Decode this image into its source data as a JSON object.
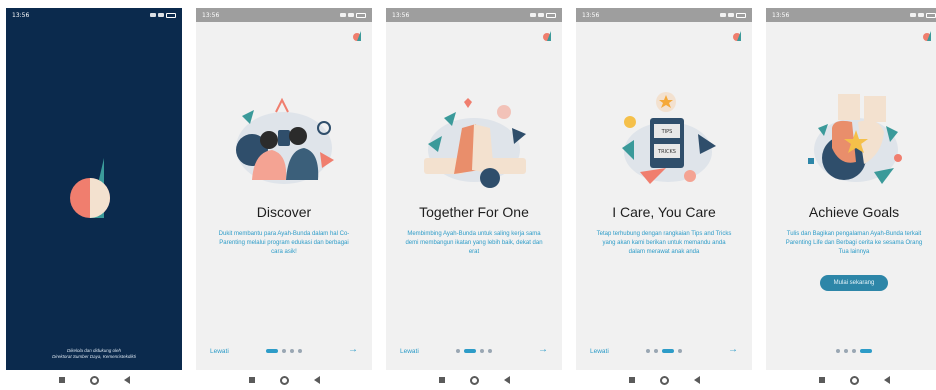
{
  "status_time": "13:56",
  "screens": [
    {
      "type": "splash",
      "footer_line1": "Dikelola dan didukung oleh",
      "footer_line2": "Direktorat Sumber Daya, Kemenristekdikti"
    },
    {
      "type": "onboarding",
      "title": "Discover",
      "description": "Dukit membantu para Ayah-Bunda dalam hal Co-Parenting melalui program edukasi dan berbagai cara asik!",
      "skip_label": "Lewati",
      "next_icon": "arrow-right-icon",
      "active_dot": 0
    },
    {
      "type": "onboarding",
      "title": "Together For One",
      "description": "Membimbing Ayah-Bunda untuk saling kerja sama demi membangun ikatan yang lebih baik, dekat dan erat",
      "skip_label": "Lewati",
      "next_icon": "arrow-right-icon",
      "active_dot": 1
    },
    {
      "type": "onboarding",
      "title": "I Care, You Care",
      "description": "Tetap terhubung dengan rangkaian Tips and Tricks yang akan kami berikan untuk memandu anda dalam merawat anak anda",
      "skip_label": "Lewati",
      "next_icon": "arrow-right-icon",
      "active_dot": 2,
      "board_top": "TIPS",
      "board_bottom": "TRICKS"
    },
    {
      "type": "final",
      "title": "Achieve Goals",
      "description": "Tulis dan Bagikan pengalaman Ayah-Bunda terkait Parenting Life dan Berbagi cerita ke sesama Orang Tua lainnya",
      "cta_label": "Mulai sekarang",
      "active_dot": 3
    }
  ],
  "colors": {
    "dark_bg": "#0b2a4d",
    "accent": "#2d9cc8",
    "salmon": "#f07e6e",
    "teal": "#3b9a9a",
    "navy": "#2f4e6b"
  }
}
